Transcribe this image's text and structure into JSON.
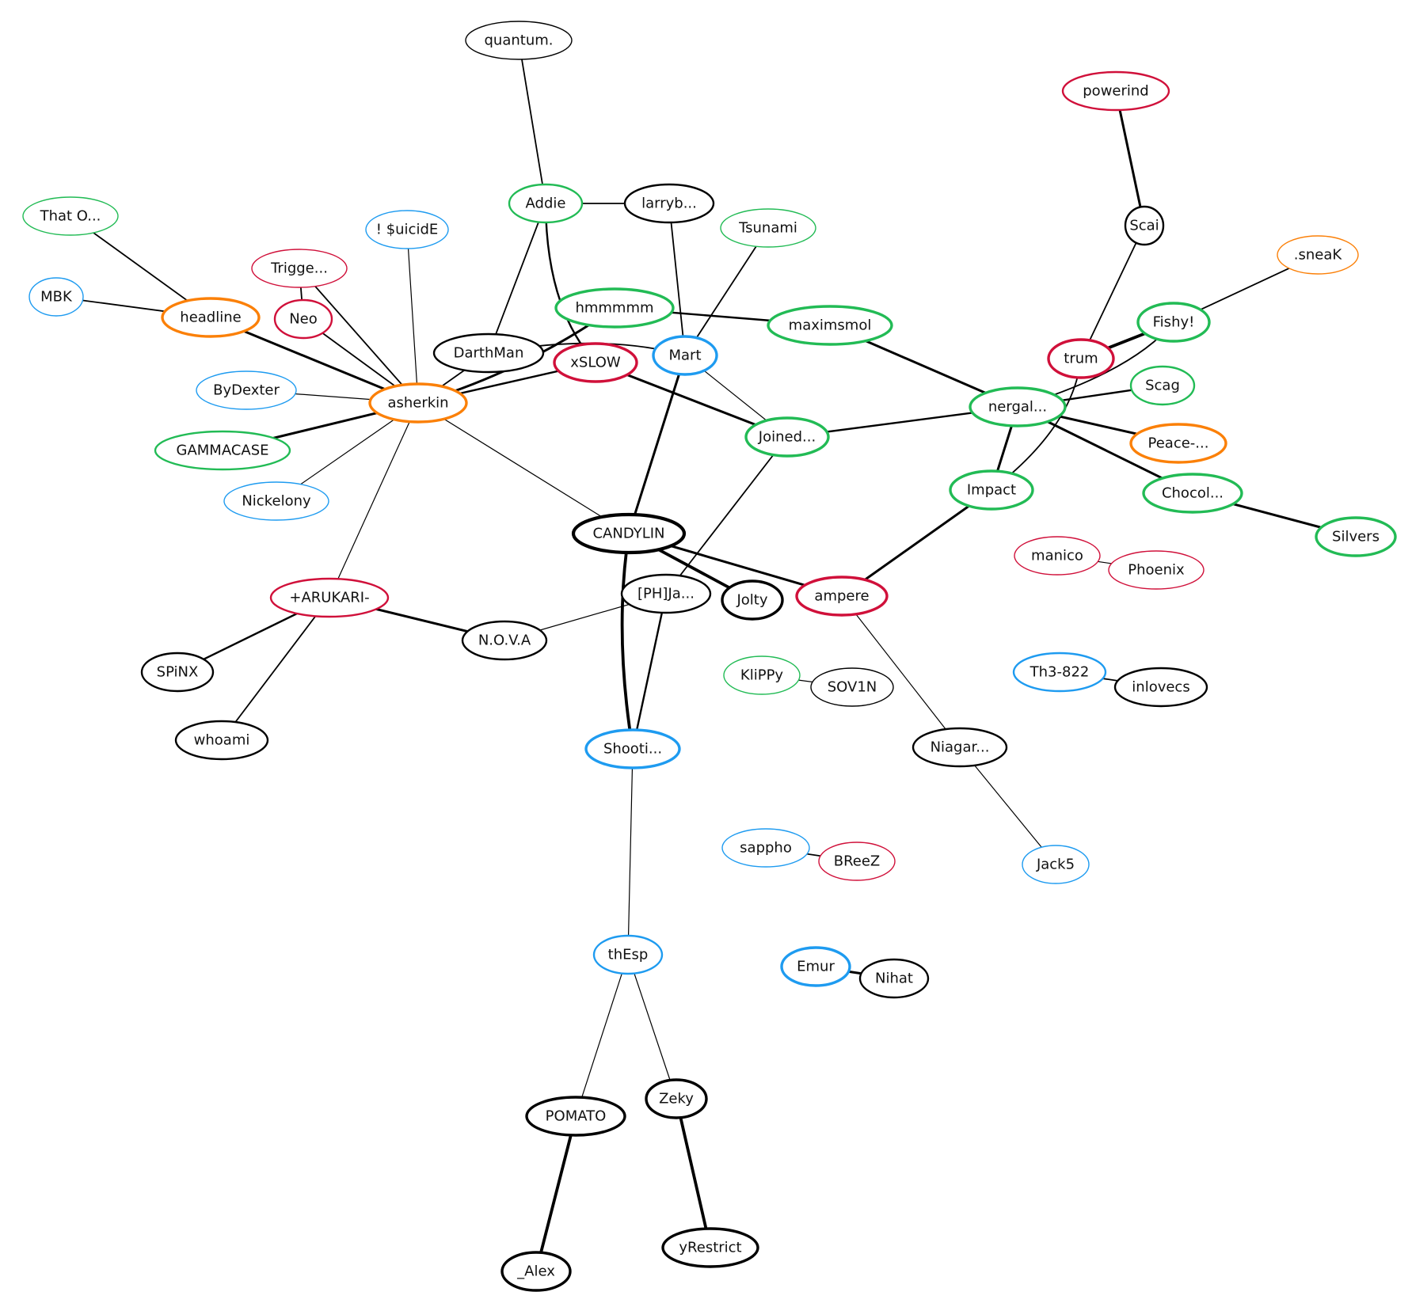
{
  "graph": {
    "type": "network",
    "colors": {
      "green": "#22bb55",
      "blue": "#1e9bf0",
      "red": "#d0103a",
      "orange": "#fb8008",
      "black": "#000000"
    },
    "nodes": [
      {
        "id": "quantum",
        "label": "quantum.",
        "color": "black",
        "weight": 1
      },
      {
        "id": "addie",
        "label": "Addie",
        "color": "green",
        "weight": 2
      },
      {
        "id": "larryb",
        "label": "larryb...",
        "color": "black",
        "weight": 2
      },
      {
        "id": "tsunami",
        "label": "Tsunami",
        "color": "green",
        "weight": 1
      },
      {
        "id": "powerind",
        "label": "powerind",
        "color": "red",
        "weight": 2
      },
      {
        "id": "scai",
        "label": "Scai",
        "color": "black",
        "weight": 2
      },
      {
        "id": "sneak",
        "label": ".sneaK",
        "color": "orange",
        "weight": 1
      },
      {
        "id": "thato",
        "label": "That O...",
        "color": "green",
        "weight": 1
      },
      {
        "id": "suicide",
        "label": "! $uicidE",
        "color": "blue",
        "weight": 1
      },
      {
        "id": "trigge",
        "label": "Trigge...",
        "color": "red",
        "weight": 1
      },
      {
        "id": "mbk",
        "label": "MBK",
        "color": "blue",
        "weight": 1
      },
      {
        "id": "headline",
        "label": "headline",
        "color": "orange",
        "weight": 3
      },
      {
        "id": "neo",
        "label": "Neo",
        "color": "red",
        "weight": 2
      },
      {
        "id": "hmmmmm",
        "label": "hmmmmm",
        "color": "green",
        "weight": 3
      },
      {
        "id": "maximsmol",
        "label": "maximsmol",
        "color": "green",
        "weight": 3
      },
      {
        "id": "darthman",
        "label": "DarthMan",
        "color": "black",
        "weight": 2
      },
      {
        "id": "xslow",
        "label": "xSLOW",
        "color": "red",
        "weight": 3
      },
      {
        "id": "mart",
        "label": "Mart",
        "color": "blue",
        "weight": 3
      },
      {
        "id": "trum",
        "label": "trum",
        "color": "red",
        "weight": 3
      },
      {
        "id": "fishy",
        "label": "Fishy!",
        "color": "green",
        "weight": 3
      },
      {
        "id": "bydexter",
        "label": "ByDexter",
        "color": "blue",
        "weight": 1
      },
      {
        "id": "asherkin",
        "label": "asherkin",
        "color": "orange",
        "weight": 3
      },
      {
        "id": "scag",
        "label": "Scag",
        "color": "green",
        "weight": 2
      },
      {
        "id": "nergal",
        "label": "nergal...",
        "color": "green",
        "weight": 3
      },
      {
        "id": "joined",
        "label": "Joined...",
        "color": "green",
        "weight": 3
      },
      {
        "id": "peace",
        "label": "Peace-...",
        "color": "orange",
        "weight": 3
      },
      {
        "id": "gammacase",
        "label": "GAMMACASE",
        "color": "green",
        "weight": 2
      },
      {
        "id": "impact",
        "label": "Impact",
        "color": "green",
        "weight": 3
      },
      {
        "id": "chocol",
        "label": "Chocol...",
        "color": "green",
        "weight": 3
      },
      {
        "id": "nickelony",
        "label": "Nickelony",
        "color": "blue",
        "weight": 1
      },
      {
        "id": "candylin",
        "label": "CANDYLIN",
        "color": "black",
        "weight": 4
      },
      {
        "id": "silvers",
        "label": "Silvers",
        "color": "green",
        "weight": 3
      },
      {
        "id": "manico",
        "label": "manico",
        "color": "red",
        "weight": 1
      },
      {
        "id": "phoenix",
        "label": "Phoenix",
        "color": "red",
        "weight": 1
      },
      {
        "id": "arukari",
        "label": "+ARUKARI-",
        "color": "red",
        "weight": 2
      },
      {
        "id": "phja",
        "label": "[PH]Ja...",
        "color": "black",
        "weight": 2
      },
      {
        "id": "jolty",
        "label": "Jolty",
        "color": "black",
        "weight": 3
      },
      {
        "id": "ampere",
        "label": "ampere",
        "color": "red",
        "weight": 3
      },
      {
        "id": "nova",
        "label": "N.O.V.A",
        "color": "black",
        "weight": 2
      },
      {
        "id": "spinx",
        "label": "SPiNX",
        "color": "black",
        "weight": 2
      },
      {
        "id": "klippy",
        "label": "KliPPy",
        "color": "green",
        "weight": 1
      },
      {
        "id": "sov1n",
        "label": "SOV1N",
        "color": "black",
        "weight": 1
      },
      {
        "id": "th3822",
        "label": "Th3-822",
        "color": "blue",
        "weight": 2
      },
      {
        "id": "inlovecs",
        "label": "inlovecs",
        "color": "black",
        "weight": 2
      },
      {
        "id": "whoami",
        "label": "whoami",
        "color": "black",
        "weight": 2
      },
      {
        "id": "shooti",
        "label": "Shooti...",
        "color": "blue",
        "weight": 3
      },
      {
        "id": "niagar",
        "label": "Niagar...",
        "color": "black",
        "weight": 2
      },
      {
        "id": "sappho",
        "label": "sappho",
        "color": "blue",
        "weight": 1
      },
      {
        "id": "breez",
        "label": "BReeZ",
        "color": "red",
        "weight": 1
      },
      {
        "id": "jack5",
        "label": "Jack5",
        "color": "blue",
        "weight": 1
      },
      {
        "id": "thesp",
        "label": "thEsp",
        "color": "blue",
        "weight": 2
      },
      {
        "id": "emur",
        "label": "Emur",
        "color": "blue",
        "weight": 3
      },
      {
        "id": "nihat",
        "label": "Nihat",
        "color": "black",
        "weight": 2
      },
      {
        "id": "zeky",
        "label": "Zeky",
        "color": "black",
        "weight": 3
      },
      {
        "id": "pomato",
        "label": "POMATO",
        "color": "black",
        "weight": 3
      },
      {
        "id": "yrestrict",
        "label": "yRestrict",
        "color": "black",
        "weight": 3
      },
      {
        "id": "alex",
        "label": "_Alex",
        "color": "black",
        "weight": 3
      }
    ],
    "edges": [
      {
        "source": "quantum",
        "target": "addie",
        "weight": 2
      },
      {
        "source": "addie",
        "target": "larryb",
        "weight": 2
      },
      {
        "source": "addie",
        "target": "darthman",
        "weight": 2
      },
      {
        "source": "addie",
        "target": "xslow",
        "weight": 3
      },
      {
        "source": "larryb",
        "target": "mart",
        "weight": 2
      },
      {
        "source": "tsunami",
        "target": "mart",
        "weight": 2
      },
      {
        "source": "hmmmmm",
        "target": "maximsmol",
        "weight": 3
      },
      {
        "source": "hmmmmm",
        "target": "asherkin",
        "weight": 4
      },
      {
        "source": "darthman",
        "target": "mart",
        "weight": 2
      },
      {
        "source": "darthman",
        "target": "asherkin",
        "weight": 2
      },
      {
        "source": "xslow",
        "target": "asherkin",
        "weight": 3
      },
      {
        "source": "xslow",
        "target": "joined",
        "weight": 4
      },
      {
        "source": "mart",
        "target": "candylin",
        "weight": 4
      },
      {
        "source": "mart",
        "target": "joined",
        "weight": 1
      },
      {
        "source": "maximsmol",
        "target": "nergal",
        "weight": 4
      },
      {
        "source": "powerind",
        "target": "scai",
        "weight": 4
      },
      {
        "source": "scai",
        "target": "trum",
        "weight": 2
      },
      {
        "source": "sneak",
        "target": "fishy",
        "weight": 2
      },
      {
        "source": "trum",
        "target": "fishy",
        "weight": 5
      },
      {
        "source": "fishy",
        "target": "nergal",
        "weight": 2
      },
      {
        "source": "trum",
        "target": "impact",
        "weight": 2
      },
      {
        "source": "nergal",
        "target": "scag",
        "weight": 3
      },
      {
        "source": "nergal",
        "target": "joined",
        "weight": 3
      },
      {
        "source": "nergal",
        "target": "peace",
        "weight": 4
      },
      {
        "source": "nergal",
        "target": "chocol",
        "weight": 4
      },
      {
        "source": "nergal",
        "target": "impact",
        "weight": 4
      },
      {
        "source": "chocol",
        "target": "silvers",
        "weight": 4
      },
      {
        "source": "impact",
        "target": "ampere",
        "weight": 4
      },
      {
        "source": "thato",
        "target": "headline",
        "weight": 2
      },
      {
        "source": "mbk",
        "target": "headline",
        "weight": 2
      },
      {
        "source": "headline",
        "target": "asherkin",
        "weight": 4
      },
      {
        "source": "trigge",
        "target": "neo",
        "weight": 2
      },
      {
        "source": "trigge",
        "target": "asherkin",
        "weight": 2
      },
      {
        "source": "neo",
        "target": "asherkin",
        "weight": 2
      },
      {
        "source": "suicide",
        "target": "asherkin",
        "weight": 1
      },
      {
        "source": "bydexter",
        "target": "asherkin",
        "weight": 1
      },
      {
        "source": "gammacase",
        "target": "asherkin",
        "weight": 4
      },
      {
        "source": "nickelony",
        "target": "asherkin",
        "weight": 1
      },
      {
        "source": "asherkin",
        "target": "arukari",
        "weight": 1
      },
      {
        "source": "asherkin",
        "target": "candylin",
        "weight": 1
      },
      {
        "source": "joined",
        "target": "phja",
        "weight": 2
      },
      {
        "source": "candylin",
        "target": "jolty",
        "weight": 5
      },
      {
        "source": "candylin",
        "target": "ampere",
        "weight": 4
      },
      {
        "source": "candylin",
        "target": "shooti",
        "weight": 5
      },
      {
        "source": "phja",
        "target": "shooti",
        "weight": 3
      },
      {
        "source": "phja",
        "target": "nova",
        "weight": 1
      },
      {
        "source": "arukari",
        "target": "nova",
        "weight": 4
      },
      {
        "source": "arukari",
        "target": "spinx",
        "weight": 3
      },
      {
        "source": "arukari",
        "target": "whoami",
        "weight": 2
      },
      {
        "source": "ampere",
        "target": "niagar",
        "weight": 1
      },
      {
        "source": "niagar",
        "target": "jack5",
        "weight": 1
      },
      {
        "source": "manico",
        "target": "phoenix",
        "weight": 1
      },
      {
        "source": "klippy",
        "target": "sov1n",
        "weight": 1
      },
      {
        "source": "th3822",
        "target": "inlovecs",
        "weight": 2
      },
      {
        "source": "sappho",
        "target": "breez",
        "weight": 2
      },
      {
        "source": "emur",
        "target": "nihat",
        "weight": 4
      },
      {
        "source": "shooti",
        "target": "thesp",
        "weight": 1
      },
      {
        "source": "thesp",
        "target": "pomato",
        "weight": 1
      },
      {
        "source": "thesp",
        "target": "zeky",
        "weight": 1
      },
      {
        "source": "pomato",
        "target": "alex",
        "weight": 5
      },
      {
        "source": "zeky",
        "target": "yrestrict",
        "weight": 5
      }
    ]
  }
}
